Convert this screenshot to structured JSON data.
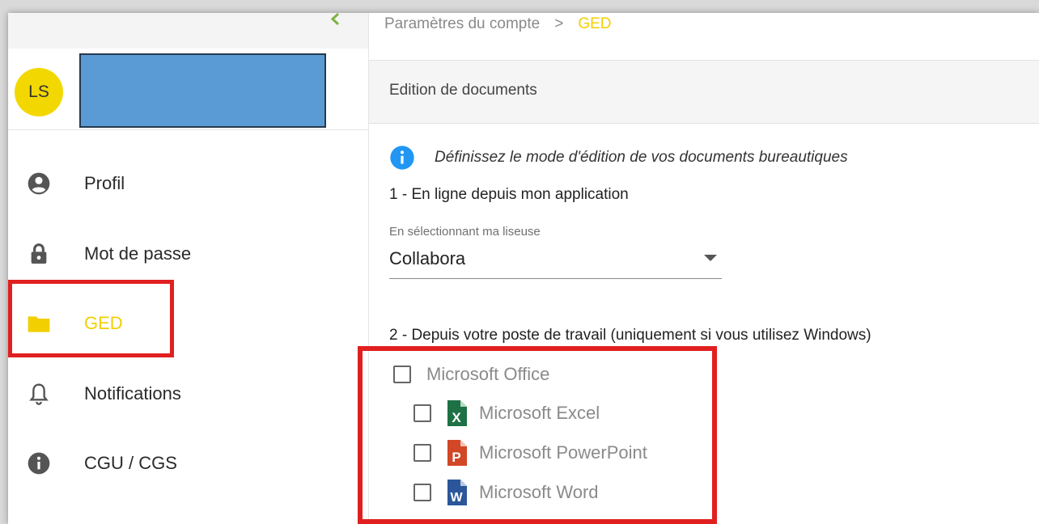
{
  "sidebar": {
    "user": {
      "initials": "LS"
    },
    "nav": [
      {
        "label": "Profil",
        "icon": "account-circle-icon"
      },
      {
        "label": "Mot de passe",
        "icon": "lock-icon"
      },
      {
        "label": "GED",
        "icon": "folder-icon",
        "active": true
      },
      {
        "label": "Notifications",
        "icon": "bell-icon"
      },
      {
        "label": "CGU / CGS",
        "icon": "info-icon"
      }
    ]
  },
  "breadcrumb": {
    "parent": "Paramètres du compte",
    "separator": ">",
    "current": "GED"
  },
  "section": {
    "title": "Edition de documents",
    "info_text": "Définissez le mode d'édition de vos documents bureautiques",
    "step1_label": "1 - En ligne depuis mon application",
    "reader_select": {
      "label": "En sélectionnant ma liseuse",
      "value": "Collabora"
    },
    "step2_label": "2 - Depuis votre poste de travail (uniquement si vous utilisez Windows)",
    "office": {
      "label": "Microsoft Office",
      "checked": false,
      "apps": [
        {
          "label": "Microsoft Excel",
          "letter": "X",
          "icon": "excel-icon",
          "checked": false
        },
        {
          "label": "Microsoft PowerPoint",
          "letter": "P",
          "icon": "powerpoint-icon",
          "checked": false
        },
        {
          "label": "Microsoft Word",
          "letter": "W",
          "icon": "word-icon",
          "checked": false
        }
      ]
    }
  },
  "colors": {
    "accent_yellow": "#f2cf00",
    "avatar_yellow": "#f2d800",
    "highlight_red": "#e02020",
    "info_blue": "#2196f3",
    "excel_green": "#1e7145",
    "powerpoint_orange": "#d24726",
    "word_blue": "#2b579a",
    "chevron_green": "#7cb342"
  }
}
